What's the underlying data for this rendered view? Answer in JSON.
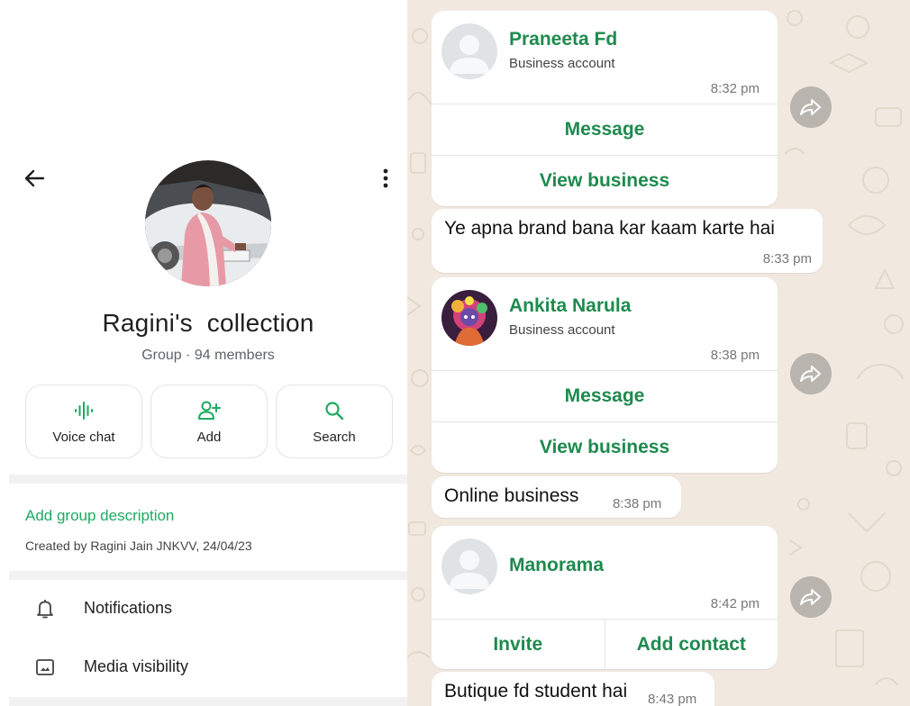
{
  "group": {
    "name": "Ragini's  collection",
    "meta": "Group · 94 members",
    "description_link": "Add group description",
    "created": "Created by Ragini Jain JNKVV, 24/04/23"
  },
  "actions": [
    {
      "label": "Voice chat",
      "icon": "voice-chat-icon"
    },
    {
      "label": "Add",
      "icon": "add-person-icon"
    },
    {
      "label": "Search",
      "icon": "search-icon"
    }
  ],
  "settings": [
    {
      "label": "Notifications",
      "icon": "bell-icon"
    },
    {
      "label": "Media visibility",
      "icon": "image-icon"
    }
  ],
  "chat": {
    "card1": {
      "name": "Praneeta Fd",
      "sub": "Business account",
      "time": "8:32 pm",
      "btn1": "Message",
      "btn2": "View business"
    },
    "msg1": {
      "text": "Ye apna brand bana kar kaam karte hai",
      "time": "8:33 pm"
    },
    "card2": {
      "name": "Ankita Narula",
      "sub": "Business account",
      "time": "8:38 pm",
      "btn1": "Message",
      "btn2": "View business"
    },
    "msg2": {
      "text": "Online business",
      "time": "8:38 pm"
    },
    "card3": {
      "name": "Manorama",
      "time": "8:42 pm",
      "btn1": "Invite",
      "btn2": "Add contact"
    },
    "msg3": {
      "text": "Butique fd student hai",
      "time": "8:43 pm"
    }
  },
  "colors": {
    "accent": "#1daa61",
    "business_green": "#1e8a4e",
    "chat_bg": "#f1e9e0",
    "forward_button": "#b9b4ae"
  }
}
